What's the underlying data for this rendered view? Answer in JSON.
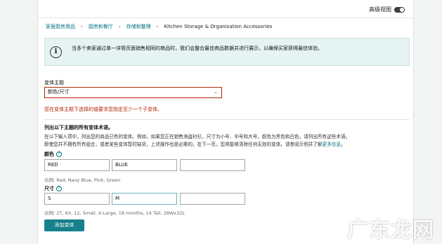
{
  "header": {
    "advanced_view_label": "高级视图"
  },
  "breadcrumb": [
    {
      "label": "家居厨房用品",
      "link": true
    },
    {
      "label": "厨房和餐厅",
      "link": true
    },
    {
      "label": "存储和整理",
      "link": true
    },
    {
      "label": "Kitchen Storage & Organization Accessories",
      "link": false
    }
  ],
  "info": {
    "text": "当多个卖家通过单一详情页面销售相同的商品时，我们会整合最佳商品数据并进行展示，以确保买家获得最佳体验。"
  },
  "variation_theme": {
    "label": "变体主题",
    "selected": "颜色/尺寸",
    "error": "您在变体主题下选择的值要求您指定至少一个子变体。"
  },
  "variations": {
    "heading": "列出以下主题的所有变体术语。",
    "description_1": "在以下输入项中，列出您的商品已有的变体。例如，如果您正在销售海盗衬衫，尺寸为小号、中号和大号，颜色为黑色和白色，请列出所有这些术语。",
    "description_2": "即使您并不拥有所有组合，或者某些变体暂时缺货，上述操作也是必需的。在下一页，您将能够清除任何无效的变体。请参阅示例并了解",
    "more_link": "更多信息",
    "period": "。",
    "color": {
      "label": "颜色",
      "values": [
        "RED",
        "BLUE",
        ""
      ],
      "example": "示例:  Red, Navy Blue, Pink, Green"
    },
    "size": {
      "label": "尺寸",
      "values": [
        "S",
        "M",
        ""
      ],
      "example": "示例:  2T, 6X, 12, Small, X-Large, 18 months, 14 Tall, 28Wx32L"
    },
    "add_button": "添加变体"
  },
  "watermark": "广东龙网",
  "colors": {
    "accent": "#007185",
    "error": "#b12704",
    "button": "#16808c",
    "info_bg": "#e6f3f3"
  }
}
